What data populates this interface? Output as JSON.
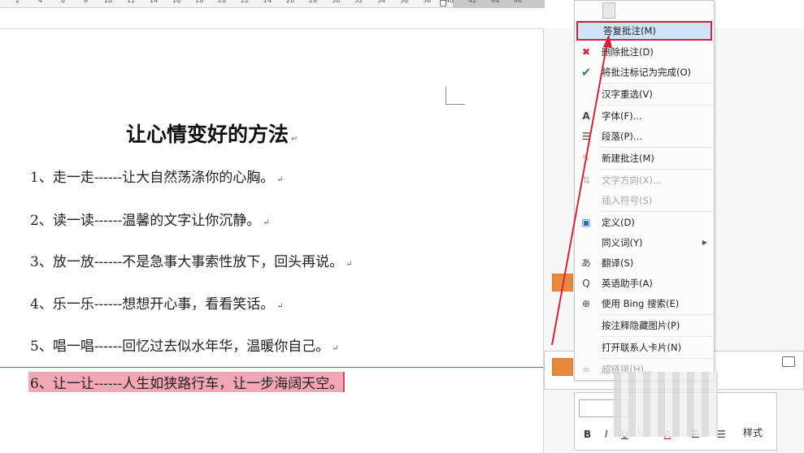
{
  "ruler": {
    "numbers": [
      "2",
      "4",
      "6",
      "8",
      "10",
      "12",
      "14",
      "16",
      "18",
      "20",
      "22",
      "24",
      "26",
      "28",
      "30",
      "32",
      "34",
      "36",
      "38",
      "40",
      "42",
      "44",
      "46"
    ]
  },
  "document": {
    "title": "让心情变好的方法",
    "lines": [
      "1、走一走------让大自然荡涤你的心胸。",
      "2、读一读------温馨的文字让你沉静。",
      "3、放一放------不是急事大事索性放下，回头再说。",
      "4、乐一乐------想想开心事，看看笑话。",
      "5、唱一唱------回忆过去似水年华，温暖你自己。",
      "6、让一让------人生如狭路行车，让一步海阔天空。"
    ],
    "paragraph_mark": "↵"
  },
  "context_menu": {
    "items": [
      {
        "label": "答复批注(M)",
        "icon": "reply-comment-icon",
        "disabled": false,
        "selected": true
      },
      {
        "label": "删除批注(D)",
        "icon": "delete-comment-icon",
        "disabled": false
      },
      {
        "label": "将批注标记为完成(O)",
        "icon": "checkmark-icon",
        "disabled": false
      },
      {
        "label": "汉字重选(V)",
        "icon": "",
        "disabled": false
      },
      {
        "label": "字体(F)...",
        "icon": "font-icon",
        "disabled": false
      },
      {
        "label": "段落(P)...",
        "icon": "paragraph-icon",
        "disabled": false
      },
      {
        "label": "新建批注(M)",
        "icon": "new-comment-icon",
        "disabled": false
      },
      {
        "label": "文字方向(X)...",
        "icon": "text-direction-icon",
        "disabled": true
      },
      {
        "label": "插入符号(S)",
        "icon": "",
        "disabled": true
      },
      {
        "label": "定义(D)",
        "icon": "define-icon",
        "disabled": false
      },
      {
        "label": "同义词(Y)",
        "icon": "",
        "disabled": false,
        "submenu": true
      },
      {
        "label": "翻译(S)",
        "icon": "translate-icon",
        "disabled": false
      },
      {
        "label": "英语助手(A)",
        "icon": "english-assistant-icon",
        "disabled": false
      },
      {
        "label": "使用 Bing 搜索(E)",
        "icon": "bing-search-icon",
        "disabled": false
      },
      {
        "label": "按注释隐藏图片(P)",
        "icon": "",
        "disabled": false
      },
      {
        "label": "打开联系人卡片(N)",
        "icon": "",
        "disabled": false
      },
      {
        "label": "超链接(H)...",
        "icon": "hyperlink-icon",
        "disabled": true
      }
    ]
  },
  "mini_toolbar": {
    "bold": "B",
    "italic": "I",
    "underline": "U",
    "font_color": "A",
    "styles_label": "样式"
  },
  "colors": {
    "highlight": "#f3a6b5",
    "selection_border": "#d9203b",
    "selection_fill": "#cde3f7",
    "comment_avatar": "#e8883f",
    "arrow": "#d9203b"
  }
}
